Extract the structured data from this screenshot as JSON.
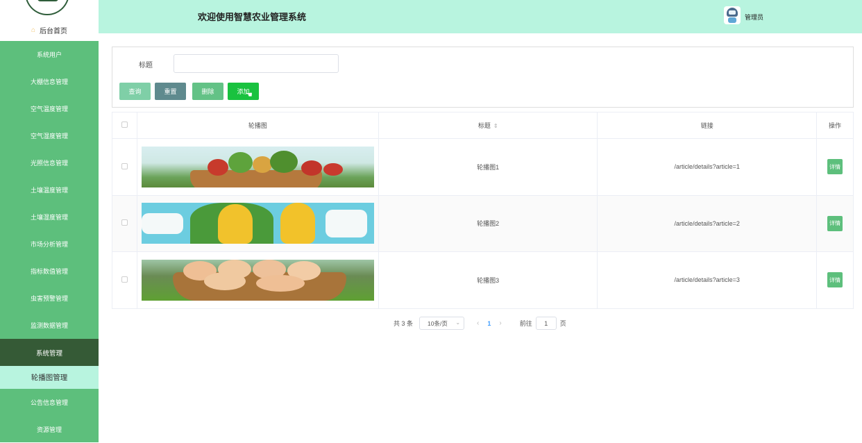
{
  "sidebar": {
    "home_label": "后台首页",
    "items": [
      {
        "label": "系统用户"
      },
      {
        "label": "大棚信息管理"
      },
      {
        "label": "空气温度管理"
      },
      {
        "label": "空气湿度管理"
      },
      {
        "label": "光照信息管理"
      },
      {
        "label": "土壤温度管理"
      },
      {
        "label": "土壤湿度管理"
      },
      {
        "label": "市场分析管理"
      },
      {
        "label": "指标数值管理"
      },
      {
        "label": "虫害预警管理"
      },
      {
        "label": "监测数据管理"
      }
    ],
    "section_label": "系统管理",
    "active_label": "轮播图管理",
    "after_items": [
      {
        "label": "公告信息管理"
      },
      {
        "label": "资源管理"
      }
    ]
  },
  "header": {
    "title": "欢迎使用智慧农业管理系统",
    "user": "管理员"
  },
  "search": {
    "label": "标题",
    "placeholder": "",
    "value": ""
  },
  "toolbar": {
    "query": "查询",
    "reset": "重置",
    "delete": "删除",
    "add": "添加"
  },
  "table": {
    "headers": {
      "image": "轮播图",
      "title": "标题",
      "link": "链接",
      "operation": "操作"
    },
    "rows": [
      {
        "title": "轮播图1",
        "link": "/article/details?article=1",
        "action": "详情"
      },
      {
        "title": "轮播图2",
        "link": "/article/details?article=2",
        "action": "详情"
      },
      {
        "title": "轮播图3",
        "link": "/article/details?article=3",
        "action": "详情"
      }
    ]
  },
  "pagination": {
    "total_text": "共 3 条",
    "page_size": "10条/页",
    "current_page": "1",
    "goto_label": "前往",
    "goto_value": "1",
    "page_suffix": "页"
  }
}
